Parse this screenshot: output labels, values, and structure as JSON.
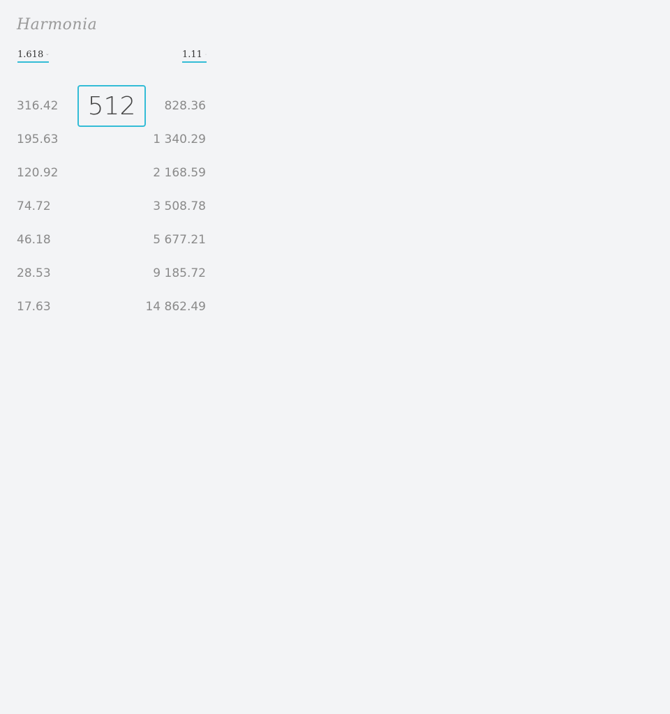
{
  "app": {
    "title": "Harmonia"
  },
  "controls": {
    "ratio_left": {
      "value": "1.618",
      "icon": "chevron-down-icon"
    },
    "ratio_right": {
      "value": "1.11",
      "icon": "chevron-down-icon"
    },
    "base_value": "512"
  },
  "scale": {
    "lower": [
      "316.42",
      "195.63",
      "120.92",
      "74.72",
      "46.18",
      "28.53",
      "17.63"
    ],
    "upper": [
      "828.36",
      "1 340.29",
      "2 168.59",
      "3 508.78",
      "5 677.21",
      "9 185.72",
      "14 862.49"
    ]
  },
  "colors": {
    "accent": "#33bcd6",
    "background": "#f3f4f6",
    "text_muted": "#8a8a8a",
    "text_dark": "#444444"
  }
}
